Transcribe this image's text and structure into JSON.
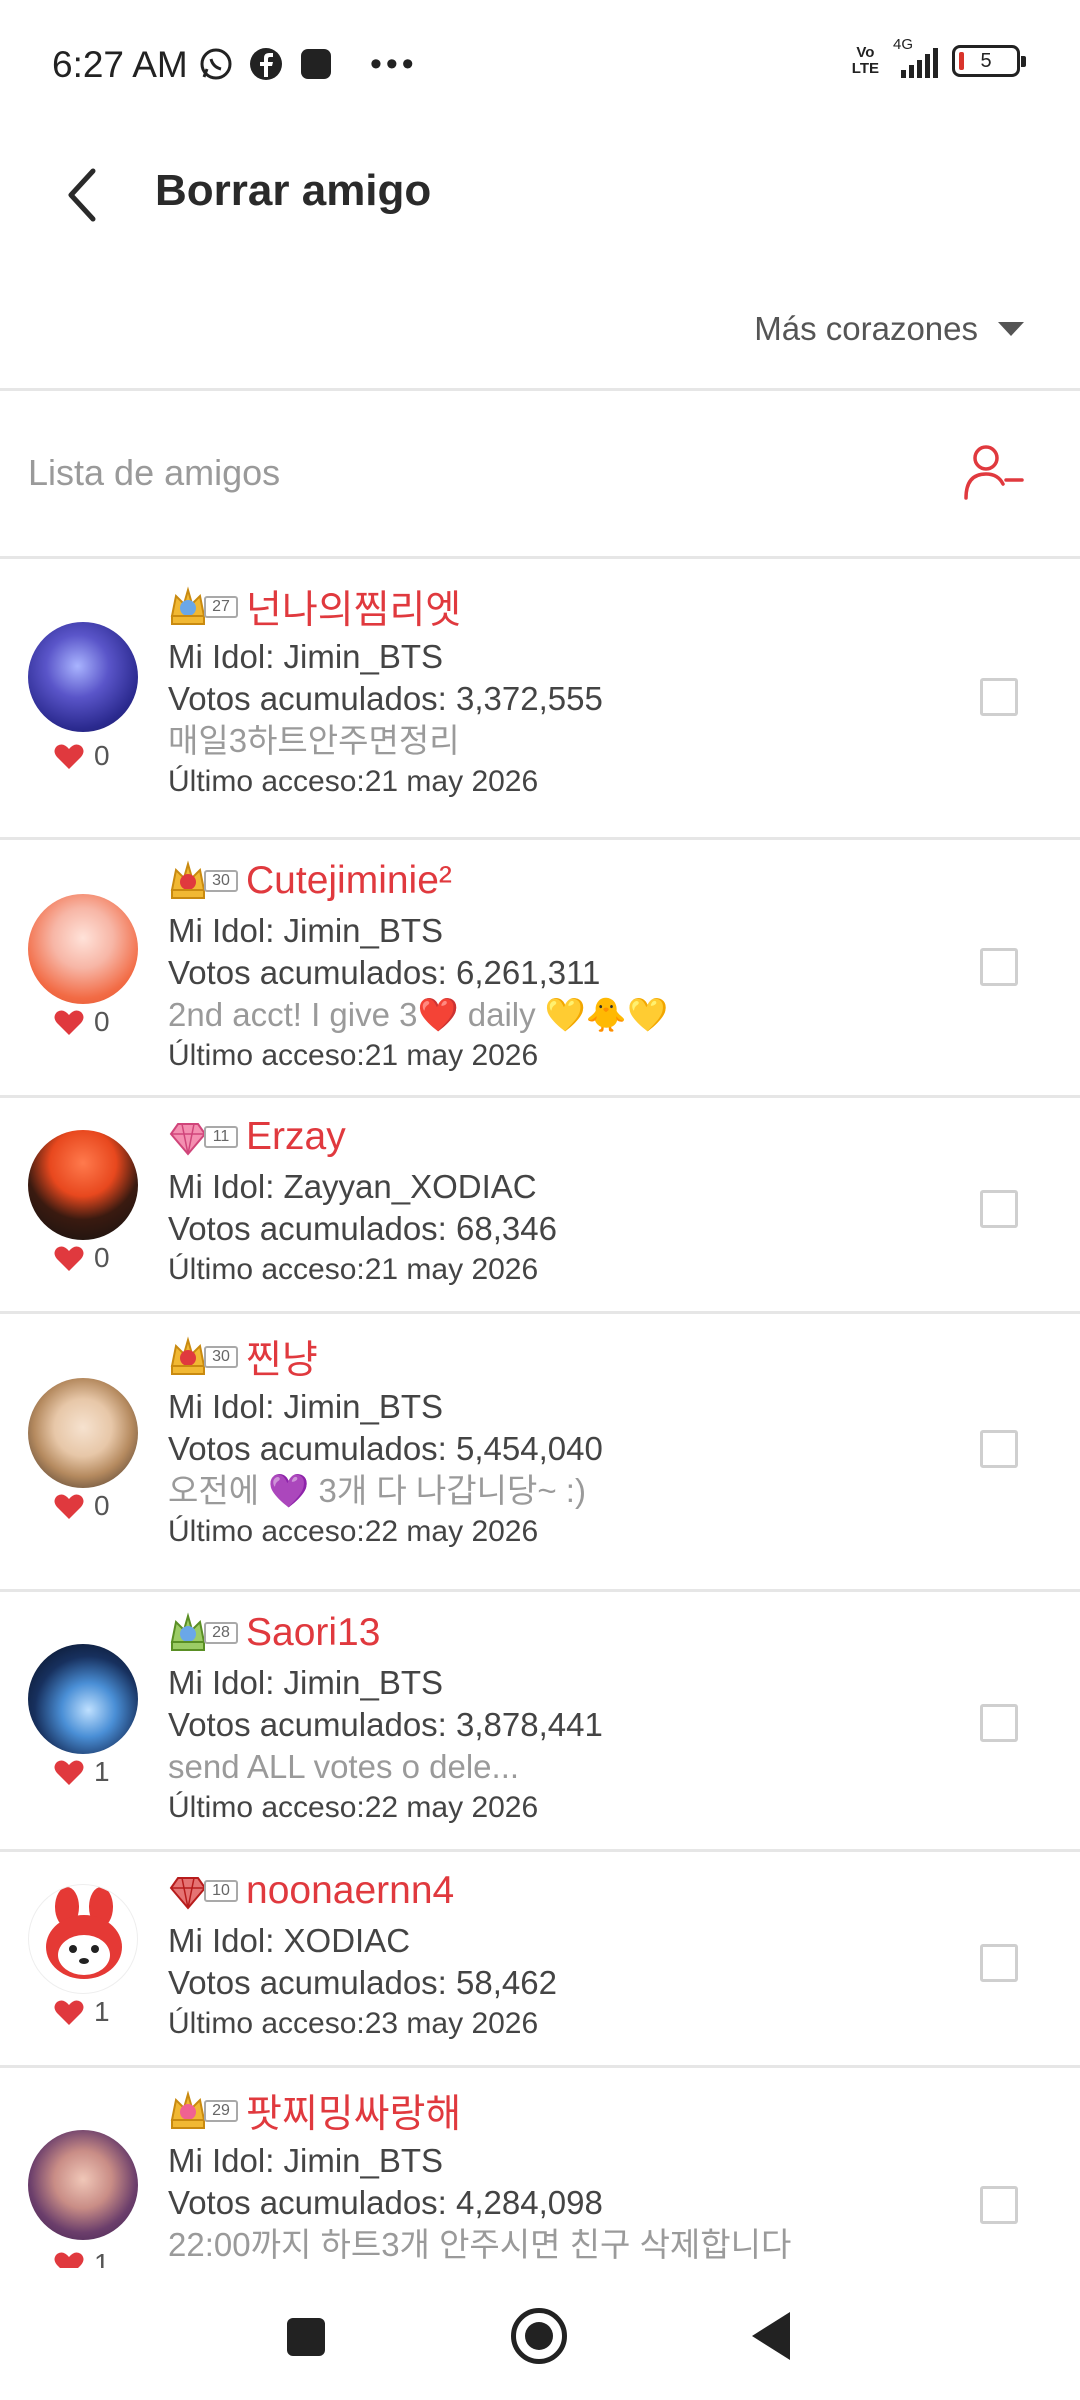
{
  "status": {
    "time": "6:27 AM",
    "network_top": "Vo",
    "network_bottom": "LTE",
    "signal_label": "4G",
    "battery": "5"
  },
  "header": {
    "title": "Borrar amigo"
  },
  "sort": {
    "label": "Más corazones"
  },
  "list": {
    "label": "Lista de amigos"
  },
  "friends": [
    {
      "level": "27",
      "name": "넌나의찜리엣",
      "idol": "Mi Idol: Jimin_BTS",
      "votes": "Votos acumulados: 3,372,555",
      "message": "매일3하트안주면정리",
      "last_access": "Último acceso:21 may 2026",
      "hearts": "0"
    },
    {
      "level": "30",
      "name": "Cutejiminie²",
      "idol": "Mi Idol: Jimin_BTS",
      "votes": "Votos acumulados: 6,261,311",
      "message": "2nd acct! I give 3❤️ daily 💛🐥💛",
      "last_access": "Último acceso:21 may 2026",
      "hearts": "0"
    },
    {
      "level": "11",
      "name": "Erzay",
      "idol": "Mi Idol: Zayyan_XODIAC",
      "votes": "Votos acumulados: 68,346",
      "message": "",
      "last_access": "Último acceso:21 may 2026",
      "hearts": "0"
    },
    {
      "level": "30",
      "name": "찐냥",
      "idol": "Mi Idol: Jimin_BTS",
      "votes": "Votos acumulados: 5,454,040",
      "message": "오전에 💜 3개 다 나갑니당~ :)",
      "last_access": "Último acceso:22 may 2026",
      "hearts": "0"
    },
    {
      "level": "28",
      "name": "Saori13",
      "idol": "Mi Idol: Jimin_BTS",
      "votes": "Votos acumulados: 3,878,441",
      "message": "send ALL  votes o dele...",
      "last_access": "Último acceso:22 may 2026",
      "hearts": "1"
    },
    {
      "level": "10",
      "name": "noonaernn4",
      "idol": "Mi Idol: XODIAC",
      "votes": "Votos acumulados: 58,462",
      "message": "",
      "last_access": "Último acceso:23 may 2026",
      "hearts": "1"
    },
    {
      "level": "29",
      "name": "팟찌밍싸랑해",
      "idol": "Mi Idol: Jimin_BTS",
      "votes": "Votos acumulados: 4,284,098",
      "message": "22:00까지  하트3개 안주시면 친구 삭제합니다",
      "last_access": "",
      "hearts": "1"
    }
  ],
  "colors": {
    "accent": "#e0393e",
    "divider": "#e6e6e6",
    "muted": "#9a9a9a"
  },
  "icons": {
    "back": "chevron-left-icon",
    "remove_friend": "user-minus-icon",
    "heart": "heart-icon",
    "dropdown": "caret-down-icon"
  }
}
